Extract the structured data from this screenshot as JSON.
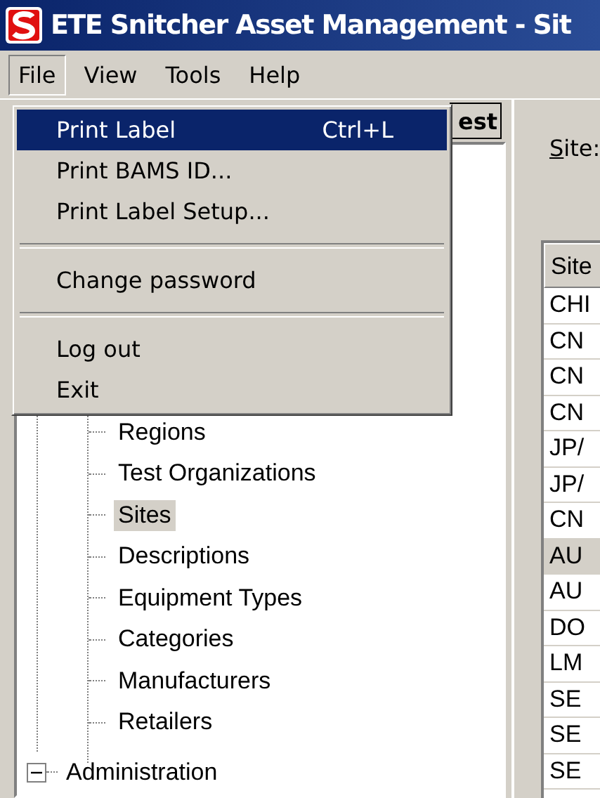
{
  "window": {
    "title": "ETE Snitcher Asset Management - Sit"
  },
  "menubar": [
    {
      "label": "File",
      "selected": true
    },
    {
      "label": "View",
      "selected": false
    },
    {
      "label": "Tools",
      "selected": false
    },
    {
      "label": "Help",
      "selected": false
    }
  ],
  "file_menu": [
    {
      "kind": "item",
      "label": "Print Label",
      "shortcut": "Ctrl+L",
      "selected": true
    },
    {
      "kind": "item",
      "label": "Print BAMS ID...",
      "selected": false
    },
    {
      "kind": "item",
      "label": "Print Label Setup...",
      "selected": false
    },
    {
      "kind": "separator"
    },
    {
      "kind": "item",
      "label": "Change password",
      "selected": false
    },
    {
      "kind": "separator"
    },
    {
      "kind": "item",
      "label": "Log out",
      "selected": false
    },
    {
      "kind": "item",
      "label": "Exit",
      "selected": false
    }
  ],
  "toolbar_button": "est",
  "tree": [
    {
      "children": [
        {
          "label": "Regions",
          "selected": false
        },
        {
          "label": "Test Organizations",
          "selected": false
        },
        {
          "label": "Sites",
          "selected": true
        },
        {
          "label": "Descriptions",
          "selected": false
        },
        {
          "label": "Equipment Types",
          "selected": false
        },
        {
          "label": "Categories",
          "selected": false
        },
        {
          "label": "Manufacturers",
          "selected": false
        },
        {
          "label": "Retailers",
          "selected": false
        }
      ]
    },
    {
      "label": "Administration",
      "expanded": true
    }
  ],
  "site_label": "Site:",
  "table": {
    "columns": [
      "Site"
    ],
    "rows": [
      {
        "cells": [
          "CHI"
        ],
        "selected": false
      },
      {
        "cells": [
          "CN"
        ],
        "selected": false
      },
      {
        "cells": [
          "CN"
        ],
        "selected": false
      },
      {
        "cells": [
          "CN"
        ],
        "selected": false
      },
      {
        "cells": [
          "JP/"
        ],
        "selected": false
      },
      {
        "cells": [
          "JP/"
        ],
        "selected": false
      },
      {
        "cells": [
          "CN"
        ],
        "selected": false
      },
      {
        "cells": [
          "AU"
        ],
        "selected": true
      },
      {
        "cells": [
          "AU"
        ],
        "selected": false
      },
      {
        "cells": [
          "DO"
        ],
        "selected": false
      },
      {
        "cells": [
          "LM"
        ],
        "selected": false
      },
      {
        "cells": [
          "SE"
        ],
        "selected": false
      },
      {
        "cells": [
          "SE"
        ],
        "selected": false
      },
      {
        "cells": [
          "SE"
        ],
        "selected": false
      }
    ]
  }
}
